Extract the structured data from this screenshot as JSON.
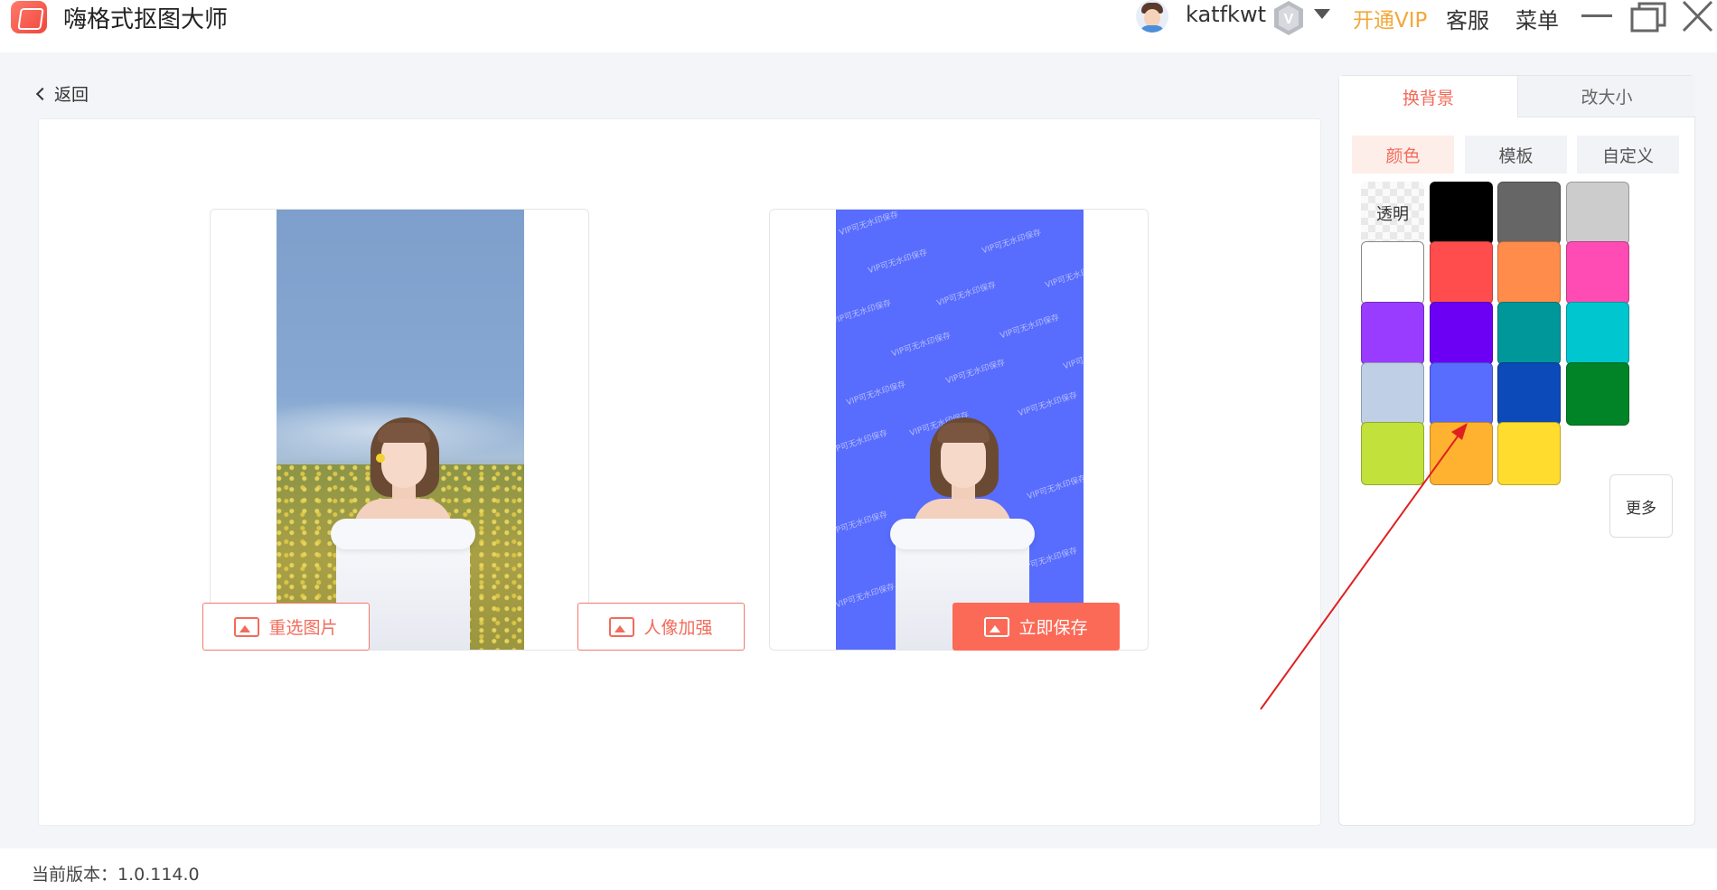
{
  "app": {
    "title": "嗨格式抠图大师"
  },
  "header": {
    "username": "katfkwt",
    "open_vip": "开通VIP",
    "service": "客服",
    "menu": "菜单",
    "vip_badge_letter": "V"
  },
  "nav": {
    "back": "返回"
  },
  "actions": {
    "reselect": "重选图片",
    "enhance": "人像加强",
    "save": "立即保存"
  },
  "watermark": "VIP可无水印保存",
  "side": {
    "tabs": [
      "换背景",
      "改大小"
    ],
    "subtabs": [
      "颜色",
      "模板",
      "自定义"
    ],
    "transparent_label": "透明",
    "more_label": "更多",
    "swatch_colors": [
      "#000000",
      "#666666",
      "#cccccc",
      "#ffffff",
      "#ff4d4d",
      "#ff8c4a",
      "#ff4bb4",
      "#9a3cff",
      "#6b00f5",
      "#00979a",
      "#00c6cf",
      "#bfd0e6",
      "#586cfd",
      "#0b4ab8",
      "#008427",
      "#c3e13b",
      "#ffb22f",
      "#ffdc2e"
    ]
  },
  "footer": {
    "version": "当前版本：1.0.114.0"
  },
  "colors": {
    "accent": "#f26b5b",
    "vip": "#f2a83a",
    "selected_bg": "#586cfd"
  }
}
